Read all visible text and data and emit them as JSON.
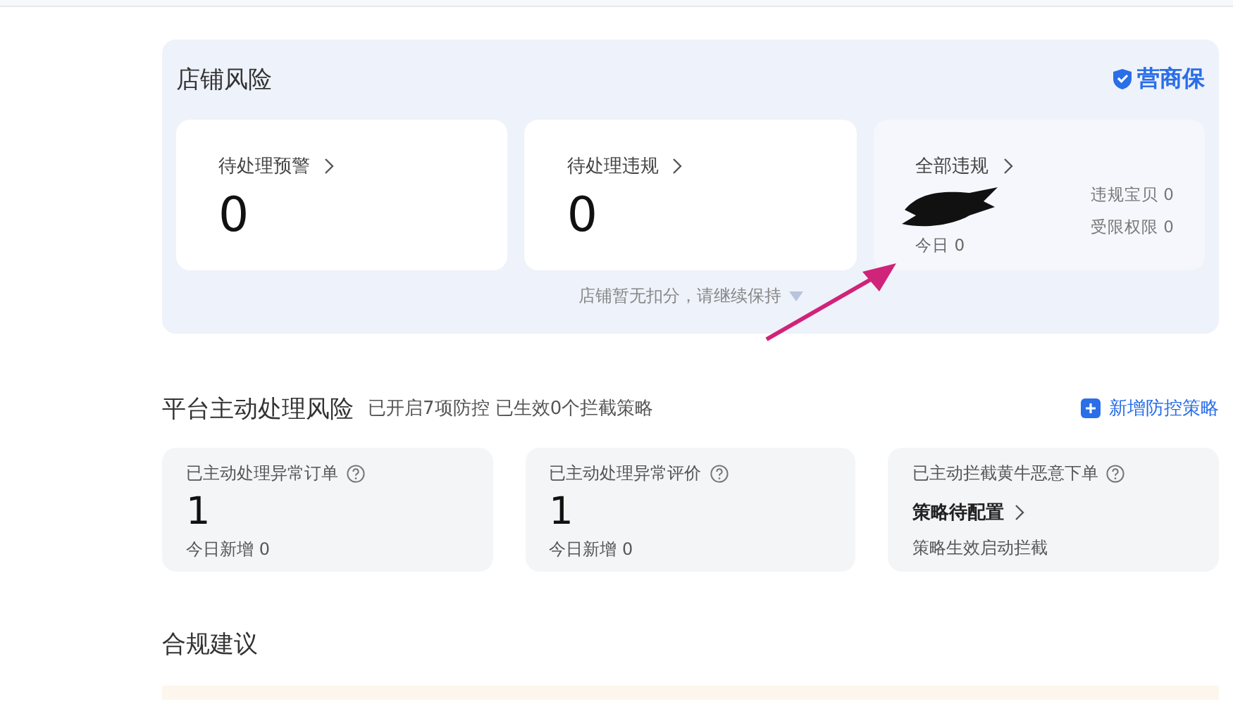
{
  "shop_risk": {
    "title": "店铺风险",
    "logo": "营商保",
    "cards": [
      {
        "kind": "count",
        "label": "待处理预警",
        "value": "0"
      },
      {
        "kind": "count",
        "label": "待处理违规",
        "value": "0"
      },
      {
        "kind": "summary",
        "label": "全部违规",
        "today": "今日 0",
        "stats": [
          "违规宝贝 0",
          "受限权限 0"
        ]
      }
    ],
    "footer": "店铺暂无扣分，请继续保持"
  },
  "platform_risk": {
    "title": "平台主动处理风险",
    "subtitle": "已开启7项防控 已生效0个拦截策略",
    "action": "新增防控策略",
    "cards": [
      {
        "kind": "count",
        "label": "已主动处理异常订单",
        "value": "1",
        "note": "今日新增 0"
      },
      {
        "kind": "count",
        "label": "已主动处理异常评价",
        "value": "1",
        "note": "今日新增 0"
      },
      {
        "kind": "link",
        "label": "已主动拦截黄牛恶意下单",
        "value": "策略待配置",
        "note": "策略生效启动拦截"
      }
    ]
  },
  "compliance": {
    "title": "合规建议"
  }
}
